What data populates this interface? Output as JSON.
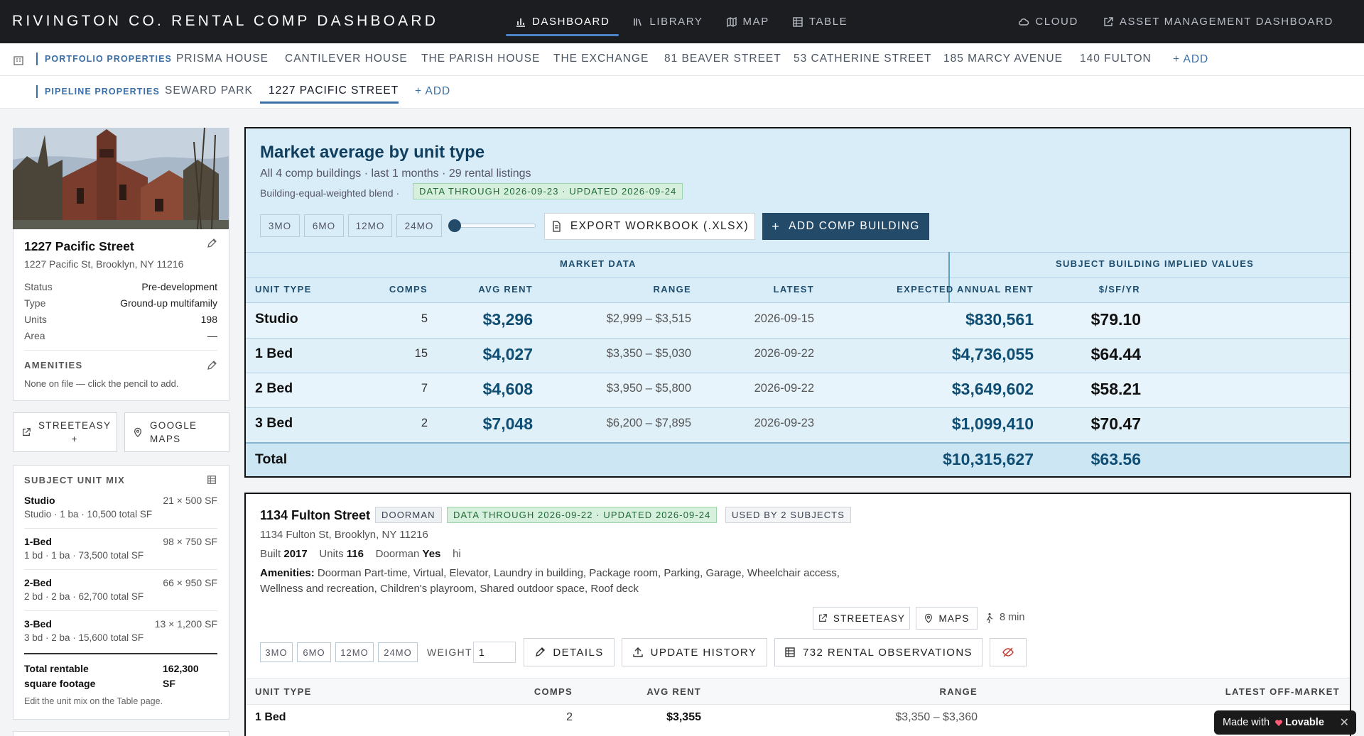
{
  "app": {
    "title": "RIVINGTON CO. RENTAL COMP DASHBOARD",
    "nav": [
      "DASHBOARD",
      "LIBRARY",
      "MAP",
      "TABLE"
    ],
    "nav_active": "DASHBOARD",
    "nav_right": [
      "CLOUD",
      "ASSET MANAGEMENT DASHBOARD"
    ]
  },
  "portfolio": {
    "label": "PORTFOLIO PROPERTIES",
    "tabs": [
      "PRISMA HOUSE",
      "CANTILEVER HOUSE",
      "THE PARISH HOUSE",
      "THE EXCHANGE",
      "81 BEAVER STREET",
      "53 CATHERINE STREET",
      "185 MARCY AVENUE",
      "140 FULTON"
    ],
    "add": "+ ADD"
  },
  "pipeline": {
    "label": "PIPELINE PROPERTIES",
    "tabs": [
      "SEWARD PARK",
      "1227 PACIFIC STREET"
    ],
    "active": "1227 PACIFIC STREET",
    "add": "+ ADD"
  },
  "subject": {
    "name": "1227 Pacific Street",
    "address": "1227 Pacific St, Brooklyn, NY 11216",
    "fields": [
      {
        "label": "Status",
        "value": "Pre-development"
      },
      {
        "label": "Type",
        "value": "Ground-up multifamily"
      },
      {
        "label": "Units",
        "value": "198"
      },
      {
        "label": "Area",
        "value": "—"
      }
    ],
    "amenities_heading": "AMENITIES",
    "amenities_note": "None on file — click the pencil to add.",
    "links": [
      "STREETEASY\n+",
      "GOOGLE\nMAPS"
    ]
  },
  "unit_mix": {
    "heading": "SUBJECT UNIT MIX",
    "rows": [
      {
        "name": "Studio",
        "sub": "Studio · 1 ba · 10,500 total SF",
        "count": "21 × 500 SF"
      },
      {
        "name": "1-Bed",
        "sub": "1 bd · 1 ba · 73,500 total SF",
        "count": "98 × 750 SF"
      },
      {
        "name": "2-Bed",
        "sub": "2 bd · 2 ba · 62,700 total SF",
        "count": "66 × 950 SF"
      },
      {
        "name": "3-Bed",
        "sub": "3 bd · 2 ba · 15,600 total SF",
        "count": "13 × 1,200 SF"
      }
    ],
    "total_label": "Total rentable square footage",
    "total_value": "162,300 SF",
    "note": "Edit the unit mix on the Table page."
  },
  "market": {
    "title": "Market average by unit type",
    "subtitle": "All 4 comp buildings · last 1 months · 29 rental listings",
    "blend": "Building-equal-weighted blend ·",
    "data_badge": "DATA THROUGH 2026-09-23 · UPDATED 2026-09-24",
    "periods": [
      "3MO",
      "6MO",
      "12MO",
      "24MO"
    ],
    "export_label": "EXPORT WORKBOOK (.XLSX)",
    "add_label": "ADD COMP BUILDING",
    "group_left": "MARKET DATA",
    "group_right": "SUBJECT BUILDING IMPLIED VALUES",
    "headers": [
      "UNIT TYPE",
      "COMPS",
      "AVG RENT",
      "RANGE",
      "LATEST",
      "EXPECTED ANNUAL RENT",
      "$/SF/YR"
    ],
    "rows": [
      {
        "unit": "Studio",
        "comps": "5",
        "avg": "$3,296",
        "range": "$2,999 – $3,515",
        "latest": "2026-09-15",
        "annual": "$830,561",
        "psf": "$79.10"
      },
      {
        "unit": "1 Bed",
        "comps": "15",
        "avg": "$4,027",
        "range": "$3,350 – $5,030",
        "latest": "2026-09-22",
        "annual": "$4,736,055",
        "psf": "$64.44"
      },
      {
        "unit": "2 Bed",
        "comps": "7",
        "avg": "$4,608",
        "range": "$3,950 – $5,800",
        "latest": "2026-09-22",
        "annual": "$3,649,602",
        "psf": "$58.21"
      },
      {
        "unit": "3 Bed",
        "comps": "2",
        "avg": "$7,048",
        "range": "$6,200 – $7,895",
        "latest": "2026-09-23",
        "annual": "$1,099,410",
        "psf": "$70.47"
      }
    ],
    "total": {
      "label": "Total",
      "annual": "$10,315,627",
      "psf": "$63.56"
    }
  },
  "comp": {
    "name": "1134 Fulton Street",
    "tag": "DOORMAN",
    "data_badge": "DATA THROUGH 2026-09-22 · UPDATED 2026-09-24",
    "used_badge": "USED BY 2 SUBJECTS",
    "address": "1134 Fulton St, Brooklyn, NY 11216",
    "built_label": "Built",
    "built": "2017",
    "units_label": "Units",
    "units": "116",
    "doorman_label": "Doorman",
    "doorman": "Yes",
    "extra": "hi",
    "amenities_label": "Amenities:",
    "amenities_1": "Doorman Part-time, Virtual, Elevator, Laundry in building, Package room, Parking, Garage, Wheelchair access,",
    "amenities_2": "Wellness and recreation, Children's playroom, Shared outdoor space, Roof deck",
    "links": [
      "STREETEASY",
      "MAPS"
    ],
    "walk": "8 min",
    "periods": [
      "3MO",
      "6MO",
      "12MO",
      "24MO"
    ],
    "weight_label": "WEIGHT",
    "weight_value": "1",
    "details_label": "DETAILS",
    "history_label": "UPDATE HISTORY",
    "observations_label": "732 RENTAL OBSERVATIONS",
    "headers": [
      "UNIT TYPE",
      "COMPS",
      "AVG RENT",
      "RANGE",
      "LATEST OFF-MARKET"
    ],
    "rows": [
      {
        "unit": "1 Bed",
        "comps": "2",
        "avg": "$3,355",
        "range": "$3,350 – $3,360"
      }
    ]
  },
  "badge_lovable": {
    "prefix": "Made with",
    "brand": "Lovable"
  },
  "colors": {
    "accent": "#3b6ea5",
    "navy": "#234a69",
    "market_bg": "#d9edf8",
    "topbar": "#1b1d21"
  }
}
